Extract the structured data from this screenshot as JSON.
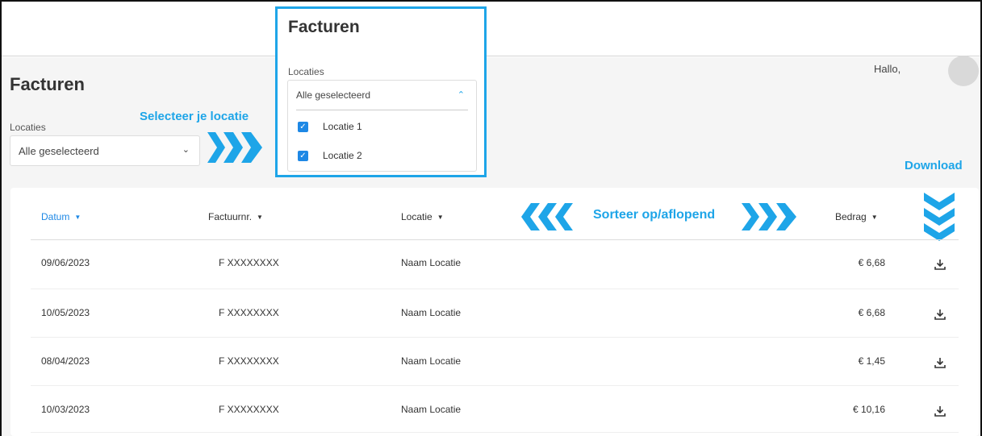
{
  "page": {
    "title": "Facturen",
    "greeting": "Hallo,",
    "location_label": "Locaties",
    "location_value": "Alle geselecteerd"
  },
  "popup": {
    "title": "Facturen",
    "label": "Locaties",
    "value": "Alle geselecteerd",
    "options": [
      {
        "label": "Locatie 1",
        "checked": true
      },
      {
        "label": "Locatie 2",
        "checked": true
      }
    ]
  },
  "annotations": {
    "select_location": "Selecteer je locatie",
    "sort": "Sorteer op/aflopend",
    "download": "Download"
  },
  "table": {
    "columns": [
      "Datum",
      "Factuurnr.",
      "Locatie",
      "Bedrag"
    ],
    "active_column": "Datum",
    "rows": [
      {
        "date": "09/06/2023",
        "invoice": "F XXXXXXXX",
        "location": "Naam Locatie",
        "amount": "€ 6,68"
      },
      {
        "date": "10/05/2023",
        "invoice": "F XXXXXXXX",
        "location": "Naam Locatie",
        "amount": "€ 6,68"
      },
      {
        "date": "08/04/2023",
        "invoice": "F XXXXXXXX",
        "location": "Naam Locatie",
        "amount": "€ 1,45"
      },
      {
        "date": "10/03/2023",
        "invoice": "F XXXXXXXX",
        "location": "Naam Locatie",
        "amount": "€ 10,16"
      }
    ]
  },
  "colors": {
    "accent": "#1e88e5",
    "annotation": "#1ea5e8",
    "background": "#f5f5f5"
  },
  "icons": [
    "chevron-down-icon",
    "chevron-up-icon",
    "checkbox-checked-icon",
    "download-icon",
    "avatar"
  ]
}
